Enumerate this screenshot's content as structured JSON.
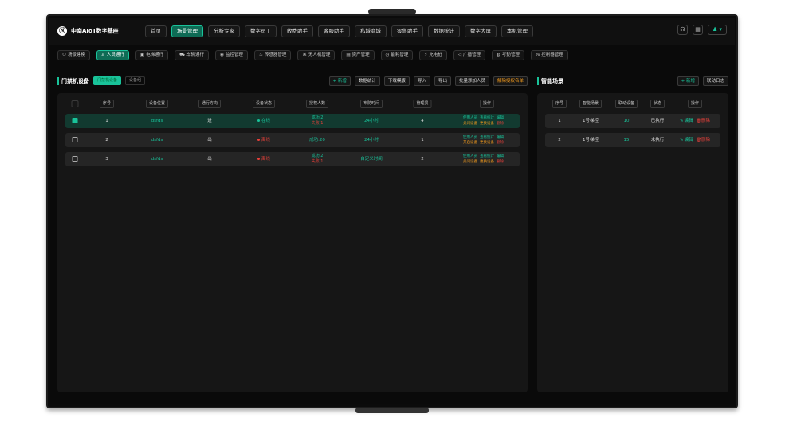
{
  "app": {
    "title": "中南AIoT数字基座",
    "logo_glyph": "Ⓝ"
  },
  "nav": [
    "首页",
    "场景管理",
    "分析专家",
    "数字员工",
    "收费助手",
    "客服助手",
    "私域商城",
    "零售助手",
    "数据统计",
    "数字大屏",
    "本机管理"
  ],
  "nav_active": 1,
  "top_icons": [
    "headset-icon",
    "app-icon",
    "user-icon"
  ],
  "subnav": [
    "场景建模",
    "人员通行",
    "电梯通行",
    "车辆通行",
    "监控管理",
    "传感器管理",
    "无人机管理",
    "资产管理",
    "能耗管理",
    "充电桩",
    "广播管理",
    "考勤管理",
    "控制器管理"
  ],
  "subnav_icons": [
    "⚇",
    "♙",
    "▣",
    "⛟",
    "◉",
    "♨",
    "⌘",
    "▤",
    "◷",
    "⚡",
    "◁",
    "◍",
    "⅜"
  ],
  "subnav_active": 1,
  "left_panel": {
    "title": "门禁机设备",
    "tabs": [
      "门禁机设备",
      "设备组"
    ],
    "actions": {
      "add": "+ 新增",
      "stats": "数据统计",
      "download": "下载模版",
      "import": "导入",
      "export": "导出",
      "batch_add": "批量添加人员",
      "revoke": "解除授权名单"
    },
    "columns": [
      "",
      "序号",
      "设备位置",
      "通行方向",
      "设备状态",
      "授权人数",
      "布防时间",
      "管理员",
      "操作"
    ],
    "rows": [
      {
        "checked": true,
        "no": "1",
        "location": "dsfds",
        "direction": "进",
        "status": "在线",
        "status_color": "#19c39a",
        "auth_ok": "成功:2",
        "auth_fail": "失败:1",
        "time": "24小时",
        "admin": "4",
        "op1": "使用人员",
        "op2": "查看统计",
        "op3": "编辑",
        "op4": "关闭设备",
        "op5": "更换设备",
        "op6": "删除"
      },
      {
        "checked": false,
        "no": "2",
        "location": "dsfds",
        "direction": "出",
        "status": "离线",
        "status_color": "#e8403a",
        "auth_ok": "成功:20",
        "auth_fail": "",
        "time": "24小时",
        "admin": "1",
        "op1": "使用人员",
        "op2": "查看统计",
        "op3": "编辑",
        "op4": "开启设备",
        "op5": "更换设备",
        "op6": "删除"
      },
      {
        "checked": false,
        "no": "3",
        "location": "dsfds",
        "direction": "出",
        "status": "离线",
        "status_color": "#e8403a",
        "auth_ok": "成功:2",
        "auth_fail": "失败:1",
        "time": "自定义时间",
        "admin": "2",
        "op1": "使用人员",
        "op2": "查看统计",
        "op3": "编辑",
        "op4": "关闭设备",
        "op5": "更换设备",
        "op6": "删除"
      }
    ]
  },
  "right_panel": {
    "title": "智能场景",
    "actions": {
      "add": "+ 新增",
      "log": "联动日志"
    },
    "columns": [
      "序号",
      "智能场景",
      "联动设备",
      "状态",
      "操作"
    ],
    "rows": [
      {
        "no": "1",
        "scene": "1号梯控",
        "devices": "10",
        "state": "已执行",
        "edit": "编辑",
        "delete": "删除"
      },
      {
        "no": "2",
        "scene": "1号梯控",
        "devices": "15",
        "state": "未执行",
        "edit": "编辑",
        "delete": "删除"
      }
    ]
  }
}
